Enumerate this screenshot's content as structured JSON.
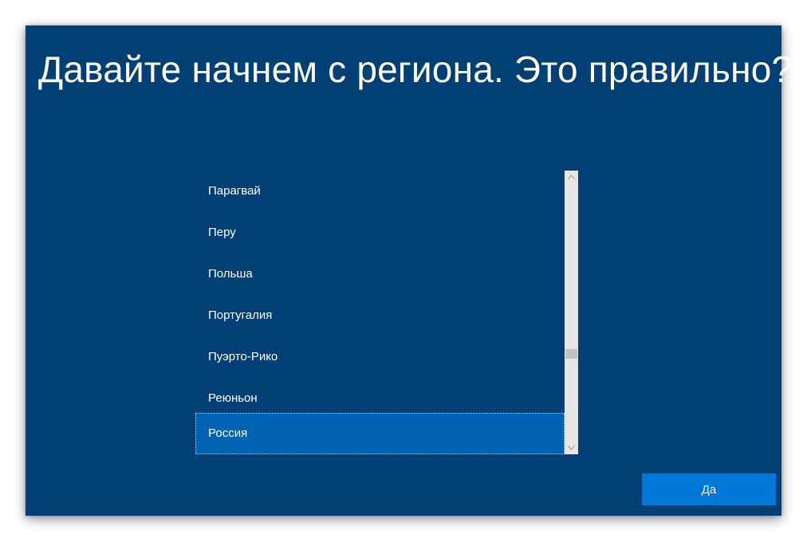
{
  "oobe": {
    "title": "Давайте начнем с региона. Это правильно?",
    "regions": [
      {
        "label": "Парагвай",
        "selected": false
      },
      {
        "label": "Перу",
        "selected": false
      },
      {
        "label": "Польша",
        "selected": false
      },
      {
        "label": "Португалия",
        "selected": false
      },
      {
        "label": "Пуэрто-Рико",
        "selected": false
      },
      {
        "label": "Реюньон",
        "selected": false
      },
      {
        "label": "Россия",
        "selected": true
      }
    ],
    "scrollbar": {
      "up_icon": "chevron-up-icon",
      "down_icon": "chevron-down-icon"
    },
    "confirm_button_label": "Да"
  },
  "colors": {
    "background": "#023f74",
    "selected_item": "#0063b1",
    "button": "#0078d7",
    "scrollbar_track": "#e6e6e6",
    "scrollbar_thumb": "#c2c2c2"
  }
}
